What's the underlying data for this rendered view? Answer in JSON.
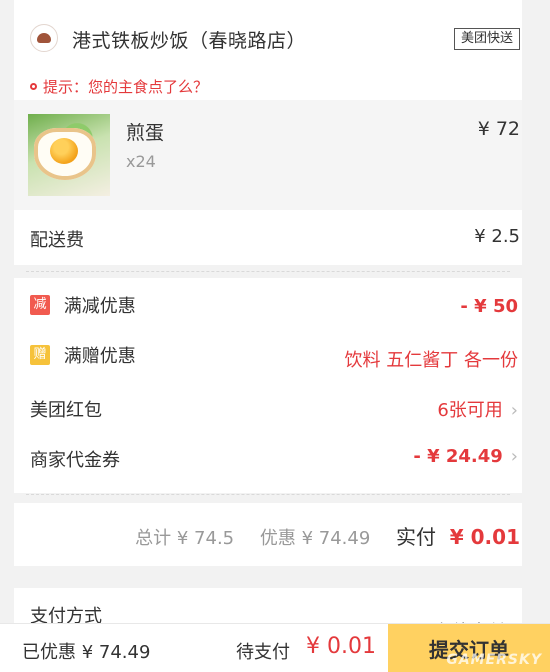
{
  "shop": {
    "name": "港式铁板炒饭（春晓路店）",
    "delivery_badge": "美团快送",
    "logo_icon": "shop-logo-icon"
  },
  "hint": {
    "text": "提示：您的主食点了么？"
  },
  "dish": {
    "name": "煎蛋",
    "quantity": "x24",
    "price": "¥ 72",
    "image_icon": "fried-egg-image"
  },
  "delivery_fee": {
    "label": "配送费",
    "value": "¥ 2.5"
  },
  "promotions": [
    {
      "tag": "减",
      "label": "满减优惠",
      "value": "- ¥ 50",
      "tag_color": "#f15a4f"
    },
    {
      "tag": "赠",
      "label": "满赠优惠",
      "value": "饮料 五仁酱丁 各一份",
      "tag_color": "#f6c23a"
    }
  ],
  "red_packet": {
    "label": "美团红包",
    "value": "6张可用",
    "chevron": "›"
  },
  "voucher": {
    "label": "商家代金券",
    "value": "- ¥ 24.49",
    "chevron": "›"
  },
  "total": {
    "total_text": "总计 ¥ 74.5",
    "discount_text": "优惠 ¥ 74.49",
    "pay_label": "实付",
    "pay_value": "¥ 0.01"
  },
  "payment": {
    "label": "支付方式",
    "value": "在线支付"
  },
  "bottom_bar": {
    "saved": "已优惠 ¥ 74.49",
    "pending_label": "待支付",
    "pending_amount": "¥ 0.01",
    "submit_label": "提交订单"
  },
  "watermark": "GAMERSKY",
  "colors": {
    "accent_red": "#e4393c",
    "submit_yellow": "#ffd161"
  }
}
